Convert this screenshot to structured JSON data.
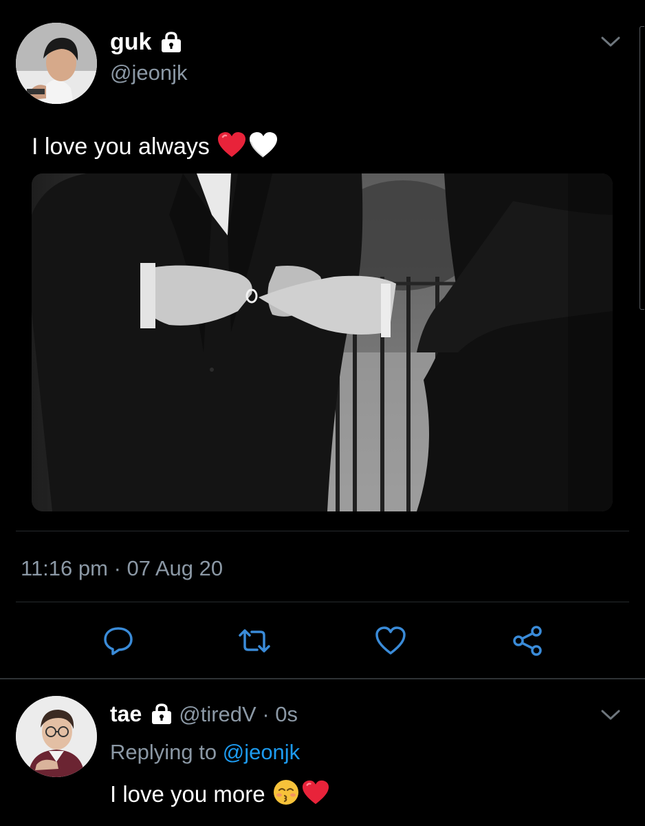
{
  "tweet": {
    "author": {
      "name": "guk",
      "handle": "@jeonjk",
      "protected_icon": "lock-icon",
      "avatar_icon": "avatar-photo"
    },
    "text": "I love you always",
    "text_emoji": [
      "red-heart",
      "white-heart"
    ],
    "media_description_icon": "photo",
    "timestamp": "11:16 pm · 07 Aug 20",
    "actions": [
      {
        "name": "reply",
        "icon": "speech-bubble-icon"
      },
      {
        "name": "retweet",
        "icon": "retweet-icon"
      },
      {
        "name": "like",
        "icon": "heart-icon"
      },
      {
        "name": "share",
        "icon": "share-icon"
      }
    ],
    "menu_icon": "chevron-down-icon"
  },
  "reply": {
    "author": {
      "name": "tae",
      "handle": "@tiredV",
      "protected_icon": "lock-icon"
    },
    "time_separator": " · ",
    "time": "0s",
    "replying_to_label": "Replying to",
    "replying_to_handle": "@jeonjk",
    "text": "I love you more",
    "text_emoji": [
      "kissing-face",
      "red-heart"
    ],
    "menu_icon": "chevron-down-icon"
  },
  "colors": {
    "background": "#000000",
    "text_primary": "#ffffff",
    "text_secondary": "#8b98a5",
    "link": "#1d9bf0",
    "divider": "#262a2e",
    "heart_red": "#e8233a"
  }
}
